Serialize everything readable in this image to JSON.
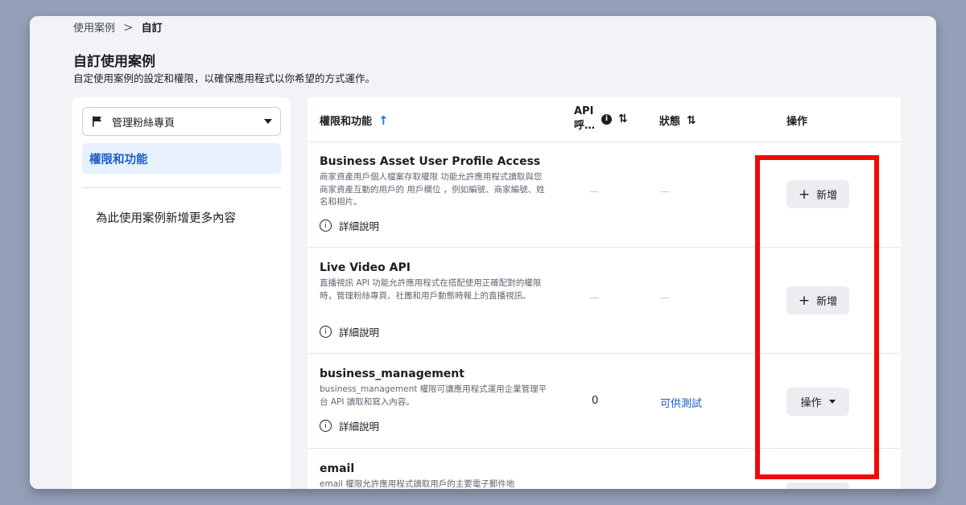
{
  "breadcrumb": {
    "parent": "使用案例",
    "separator": ">",
    "current": "自訂"
  },
  "page": {
    "title": "自訂使用案例",
    "subtitle": "自定使用案例的設定和權限，以確保應用程式以你希望的方式運作。"
  },
  "sidebar": {
    "dropdown_label": "管理粉絲專頁",
    "active_item": "權限和功能",
    "add_more": "為此使用案例新增更多內容"
  },
  "table": {
    "headers": {
      "permissions": "權限和功能",
      "api_line1": "API",
      "api_line2": "呼…",
      "status": "狀態",
      "action": "操作"
    },
    "rows": [
      {
        "title": "Business Asset User Profile Access",
        "desc": "商家資產用戶個人檔案存取權限 功能允許應用程式讀取與您商家資產互動的用戶的 用戶欄位 ，例如編號、商家編號、姓名和相片。",
        "more": "詳細說明",
        "api": "—",
        "status": "—",
        "button": "新增"
      },
      {
        "title": "Live Video API",
        "desc": "直播視訊 API 功能允許應用程式在搭配使用正確配對的權限時，管理粉絲專頁、社團和用戶動態時報上的直播視訊。",
        "more": "詳細說明",
        "api": "—",
        "status": "—",
        "button": "新增"
      },
      {
        "title": "business_management",
        "desc": "business_management 權限可讓應用程式運用企業管理平台 API 讀取和寫入內容。",
        "more": "詳細說明",
        "api": "0",
        "status": "可供測試",
        "button": "操作"
      },
      {
        "title": "email",
        "desc": "email 權限允許應用程式讀取用戶的主要電子郵件地"
      }
    ]
  },
  "colors": {
    "highlight": "#ef0a0a",
    "link": "#1b5fc5",
    "accent": "#1b74e4"
  },
  "icons": [
    "flag-icon",
    "chevron-down-icon",
    "sort-ascending-icon",
    "info-icon",
    "sort-icon",
    "plus-icon",
    "info-circle-icon",
    "caret-down-icon"
  ]
}
